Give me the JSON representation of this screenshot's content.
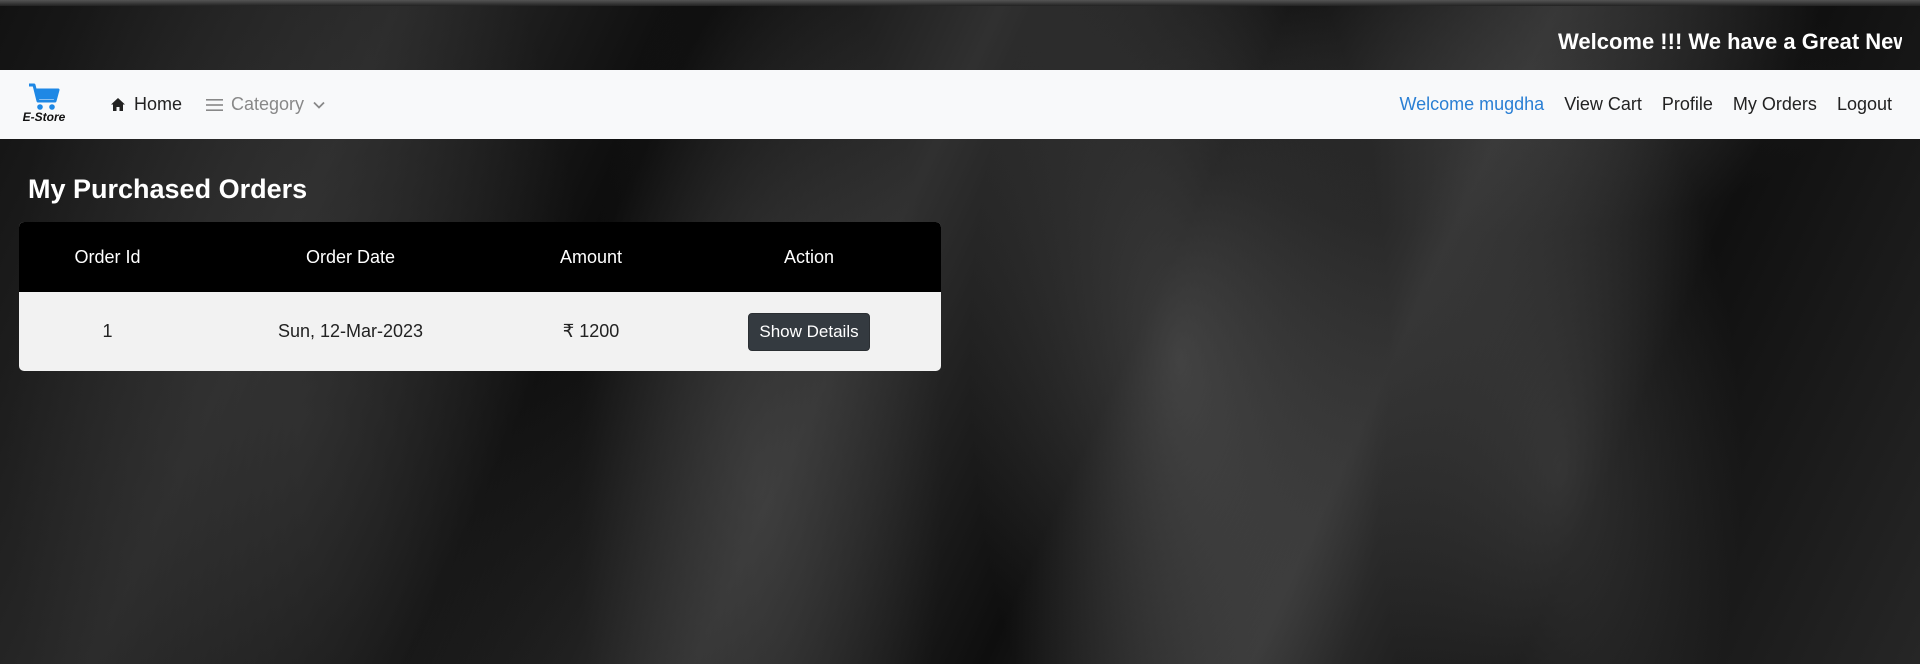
{
  "marquee": {
    "text": "Welcome !!! We have a Great News"
  },
  "navbar": {
    "brand_label": "E-Store",
    "home_label": "Home",
    "category_label": "Category",
    "welcome_text": "Welcome mugdha",
    "view_cart_label": "View Cart",
    "profile_label": "Profile",
    "my_orders_label": "My Orders",
    "logout_label": "Logout"
  },
  "main": {
    "title": "My Purchased Orders",
    "columns": [
      "Order Id",
      "Order Date",
      "Amount",
      "Action"
    ],
    "rows": [
      {
        "order_id": "1",
        "order_date": "Sun, 12-Mar-2023",
        "amount": "₹ 1200",
        "action_label": "Show Details"
      }
    ]
  },
  "colors": {
    "brand_icon": "#1e88e5",
    "welcome_link": "#2a7fd4",
    "navbar_bg": "#f8f9fa",
    "table_header_bg": "#000000",
    "button_bg": "#343a40"
  },
  "icons": {
    "brand": "cart-icon",
    "home": "home-icon",
    "category": "menu-icon",
    "category_caret": "chevron-down-icon"
  }
}
